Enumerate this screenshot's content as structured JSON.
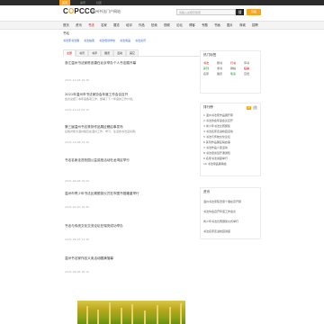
{
  "topbar": {
    "tabs": [
      "首页",
      "资讯",
      "社区"
    ]
  },
  "header": {
    "logo_prefix": "C",
    "logo_o": "O",
    "logo_suffix": "PCCC",
    "tagline": "温州书法门户网站",
    "search_placeholder": "请输入关键字搜索",
    "search_button": "搜",
    "search_button2": "高级"
  },
  "nav": [
    "首页",
    "资讯",
    "书法",
    "名家",
    "展览",
    "培训",
    "作品",
    "拍卖",
    "视频",
    "论坛",
    "博客",
    "专题",
    "书画",
    "图片",
    "商城",
    "招聘"
  ],
  "breadcrumb": "书坛",
  "subtabs": [
    "书法家书法展",
    "书法拍卖",
    "书法培训学校",
    "书法用品",
    "书法资讯"
  ],
  "filter_tabs": [
    "全部",
    "书讯",
    "书评",
    "展览",
    "活动",
    "其它"
  ],
  "articles": [
    {
      "title": "浙江温州书法家陈忠康在北京举办个人书法展开幕",
      "summary": "",
      "time": "2021-10-18 16:30"
    },
    {
      "title": "2021年温州市书法家协会年度工作会议召开",
      "summary": "会议总结了本年度各项工作，部署了下一年度的工作计划。",
      "time": "2021-10-12 09:15"
    },
    {
      "title": "第三届温州书法篆刻作品展征稿启事发布",
      "summary": "征稿对象为温州籍及在温州工作、学习、生活的书法爱好者。",
      "time": "2021-10-08 14:20"
    },
    {
      "title": "书法名家走进校园公益讲座活动在龙湾区举行",
      "summary": "",
      "time": "2021-09-28 10:00"
    },
    {
      "title": "温州市青少年书法比赛颁奖仪式在市图书馆隆重举行",
      "summary": "",
      "time": "2021-09-20 15:45"
    },
    {
      "title": "书法与传统文化交流论坛在瑞安成功举办",
      "summary": "",
      "time": "2021-09-15 11:30"
    },
    {
      "title": "温州书法家作品义卖活动圆满落幕",
      "summary": "",
      "time": "2021-09-06 16:10"
    }
  ],
  "sidebar": {
    "hot_title": "热门标签",
    "hot_tags": [
      "书法",
      "楷书",
      "行书",
      "草书",
      "篆刻",
      "隶书",
      "碑帖",
      "临摹",
      "名家",
      "展览",
      "笔墨",
      "宣纸"
    ],
    "rank_title": "排行榜",
    "rank_badges": [
      "周",
      "月"
    ],
    "rank_items": [
      "1 温州书法家作品展开幕",
      "2 书法协会年度会议召开",
      "3 青少年书法比赛颁奖",
      "4 书法名家走进校园活动",
      "5 书法与传统文化论坛",
      "6 篆刻作品展征稿启事",
      "7 书法作品义卖活动",
      "8 书法培训班开课通知",
      "9 名家书法讲座举行",
      "10 书法用品展销会"
    ],
    "news_title": "资讯",
    "news_items": [
      "温州书法家陈忠康个展在京开幕",
      "书法协会召开年度工作会议",
      "青少年书法比赛颁奖仪式举行",
      "书法名家走进校园讲座"
    ]
  }
}
